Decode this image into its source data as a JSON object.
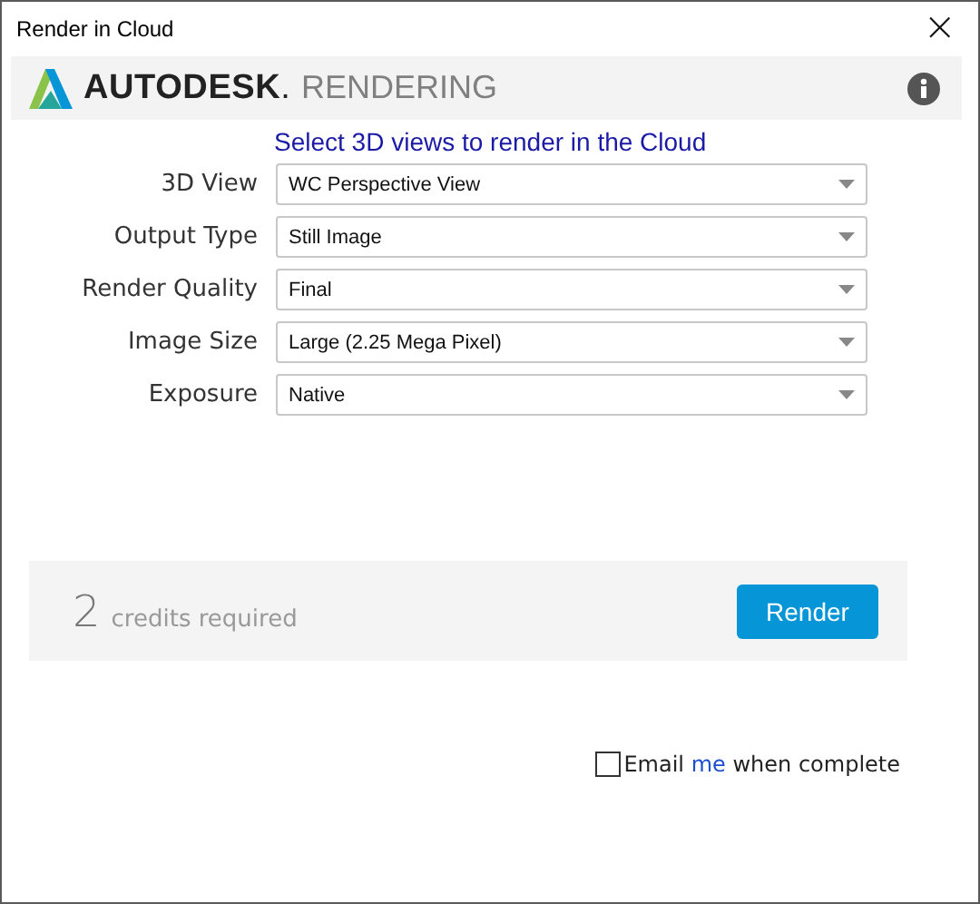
{
  "window": {
    "title": "Render in Cloud",
    "close": "×"
  },
  "header": {
    "brand": "AUTODESK",
    "dot": ".",
    "product": "RENDERING"
  },
  "heading": "Select 3D views to render in the Cloud",
  "fields": [
    {
      "label": "3D View",
      "value": "WC Perspective View"
    },
    {
      "label": "Output Type",
      "value": "Still Image"
    },
    {
      "label": "Render Quality",
      "value": "Final"
    },
    {
      "label": "Image Size",
      "value": "Large (2.25 Mega Pixel)"
    },
    {
      "label": "Exposure",
      "value": "Native"
    }
  ],
  "credits": {
    "count": "2",
    "text": "credits required"
  },
  "render_button": "Render",
  "email": {
    "checked": false,
    "before": "Email ",
    "highlight": "me",
    "after": " when complete"
  }
}
